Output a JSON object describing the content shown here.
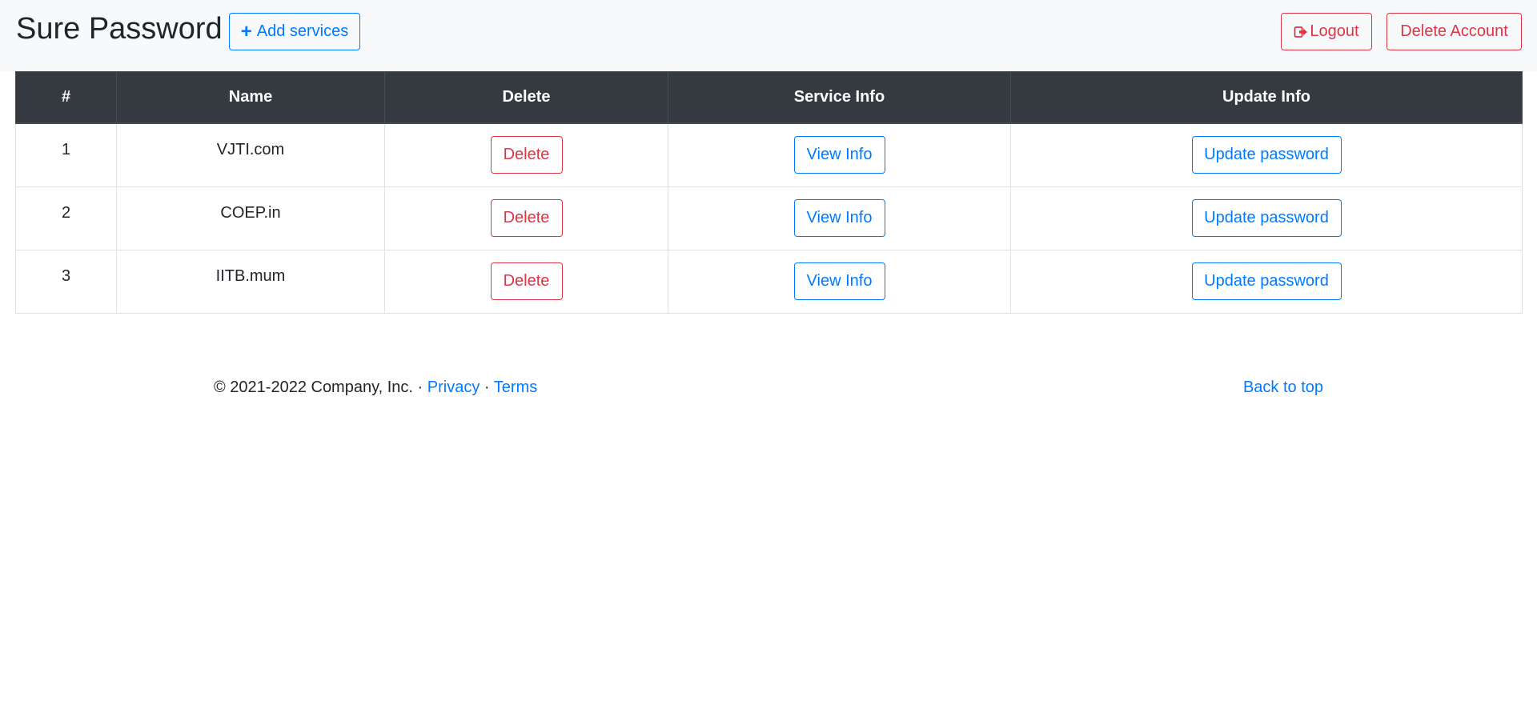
{
  "header": {
    "brand": "Sure Password",
    "add_label": "Add services",
    "logout_label": "Logout",
    "delete_account_label": "Delete Account"
  },
  "table": {
    "columns": [
      "#",
      "Name",
      "Delete",
      "Service Info",
      "Update Info"
    ],
    "rows": [
      {
        "index": "1",
        "name": "VJTI.com",
        "delete": "Delete",
        "info": "View Info",
        "update": "Update password"
      },
      {
        "index": "2",
        "name": "COEP.in",
        "delete": "Delete",
        "info": "View Info",
        "update": "Update password"
      },
      {
        "index": "3",
        "name": "IITB.mum",
        "delete": "Delete",
        "info": "View Info",
        "update": "Update password"
      }
    ]
  },
  "footer": {
    "copyright": "© 2021-2022 Company, Inc.",
    "separator": "·",
    "privacy": "Privacy",
    "terms": "Terms",
    "back_to_top": "Back to top"
  },
  "colors": {
    "primary": "#007bff",
    "danger": "#dc3545",
    "table_header_bg": "#343a40",
    "navbar_bg": "#f8f9fa"
  },
  "icons": {
    "add": "plus-icon",
    "logout": "sign-out-icon"
  }
}
